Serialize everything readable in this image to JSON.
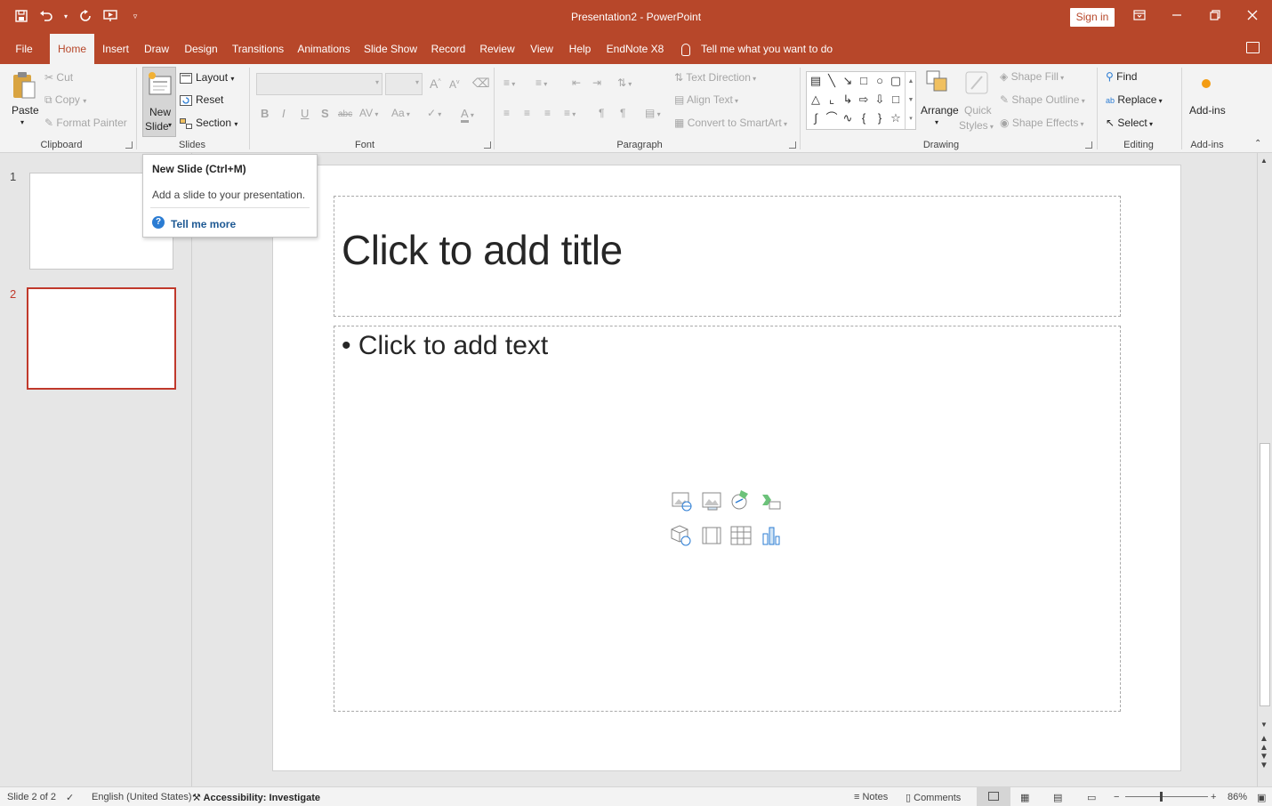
{
  "titlebar": {
    "document_title": "Presentation2  -  PowerPoint",
    "signin_label": "Sign in",
    "qat_icons": [
      "save-icon",
      "undo-icon",
      "redo-icon",
      "present-from-beginning-icon",
      "customize-qat-icon"
    ]
  },
  "tabs": [
    "File",
    "Home",
    "Insert",
    "Draw",
    "Design",
    "Transitions",
    "Animations",
    "Slide Show",
    "Record",
    "Review",
    "View",
    "Help",
    "EndNote X8"
  ],
  "active_tab": "Home",
  "tellme_placeholder": "Tell me what you want to do",
  "ribbon": {
    "clipboard": {
      "label": "Clipboard",
      "paste": "Paste",
      "cut": "Cut",
      "copy": "Copy",
      "format_painter": "Format Painter"
    },
    "slides": {
      "label": "Slides",
      "new_slide_line1": "New",
      "new_slide_line2": "Slide",
      "layout": "Layout",
      "reset": "Reset",
      "section": "Section"
    },
    "font": {
      "label": "Font",
      "bold": "B",
      "italic": "I",
      "underline": "U",
      "shadow": "S",
      "strike": "abc",
      "spacing": "AV",
      "case": "Aa",
      "color": "A",
      "grow": "A",
      "shrink": "A"
    },
    "paragraph": {
      "label": "Paragraph",
      "text_direction": "Text Direction",
      "align_text": "Align Text",
      "convert_smartart": "Convert to SmartArt"
    },
    "drawing": {
      "label": "Drawing",
      "arrange": "Arrange",
      "quick_styles_line1": "Quick",
      "quick_styles_line2": "Styles",
      "shape_fill": "Shape Fill",
      "shape_outline": "Shape Outline",
      "shape_effects": "Shape Effects"
    },
    "editing": {
      "label": "Editing",
      "find": "Find",
      "replace": "Replace",
      "select": "Select"
    },
    "addins": {
      "label": "Add-ins",
      "button": "Add-ins"
    }
  },
  "tooltip": {
    "title": "New Slide (Ctrl+M)",
    "description": "Add a slide to your presentation.",
    "link": "Tell me more"
  },
  "thumbnails": [
    {
      "number": "1",
      "selected": false
    },
    {
      "number": "2",
      "selected": true
    }
  ],
  "slide": {
    "title_placeholder": "Click to add title",
    "body_placeholder": "Click to add text",
    "insert_icons": [
      "stock-images-icon",
      "pictures-icon",
      "icons-icon",
      "smartart-icon",
      "3d-models-icon",
      "video-icon",
      "table-icon",
      "chart-icon"
    ]
  },
  "statusbar": {
    "slide_info": "Slide 2 of 2",
    "language": "English (United States)",
    "accessibility": "Accessibility: Investigate",
    "notes": "Notes",
    "comments": "Comments",
    "zoom": "86%"
  },
  "colors": {
    "accent": "#b7472a",
    "ribbon_bg": "#f3f3f3",
    "workspace_bg": "#e6e6e6",
    "selection_border": "#c0392b",
    "link": "#1f5a94"
  }
}
